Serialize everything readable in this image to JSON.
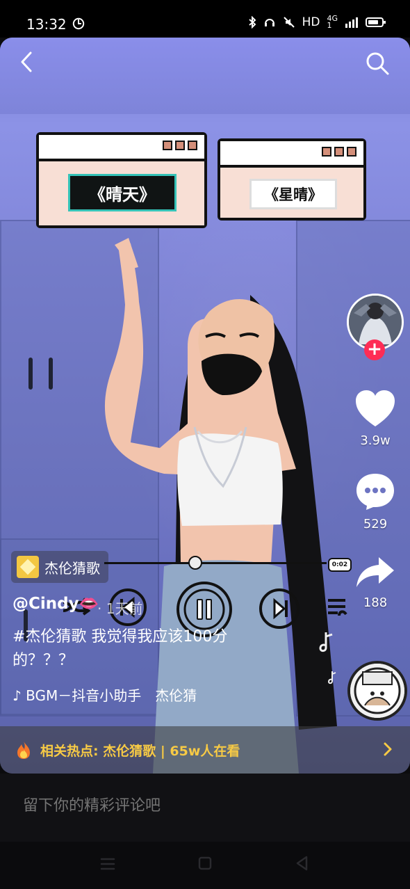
{
  "status": {
    "time": "13:32",
    "hd": "HD",
    "network_top": "4G",
    "network_bottom": "1"
  },
  "top_bar": {
    "back_icon": "back-arrow-icon",
    "search_icon": "search-icon"
  },
  "song_cards": [
    {
      "title": "《晴天》",
      "selected": true
    },
    {
      "title": "《星晴》",
      "selected": false
    }
  ],
  "side_actions": {
    "likes": "3.9w",
    "comments": "529",
    "shares": "188"
  },
  "music_tag": {
    "label": "杰伦猜歌"
  },
  "player": {
    "time": "0:02",
    "progress": 0.41
  },
  "post": {
    "author": "@Cindy👄",
    "meta": "· 1天前",
    "description": "#杰伦猜歌 我觉得我应该100分的？？？",
    "bgm": "BGM－抖音小助手　杰伦猜"
  },
  "hot_banner": {
    "text": "相关热点: 杰伦猜歌 | 65w人在看"
  },
  "comment_input": {
    "placeholder": "留下你的精彩评论吧"
  },
  "colors": {
    "follow": "#fe2c55",
    "hot_text": "#f7ca45"
  }
}
